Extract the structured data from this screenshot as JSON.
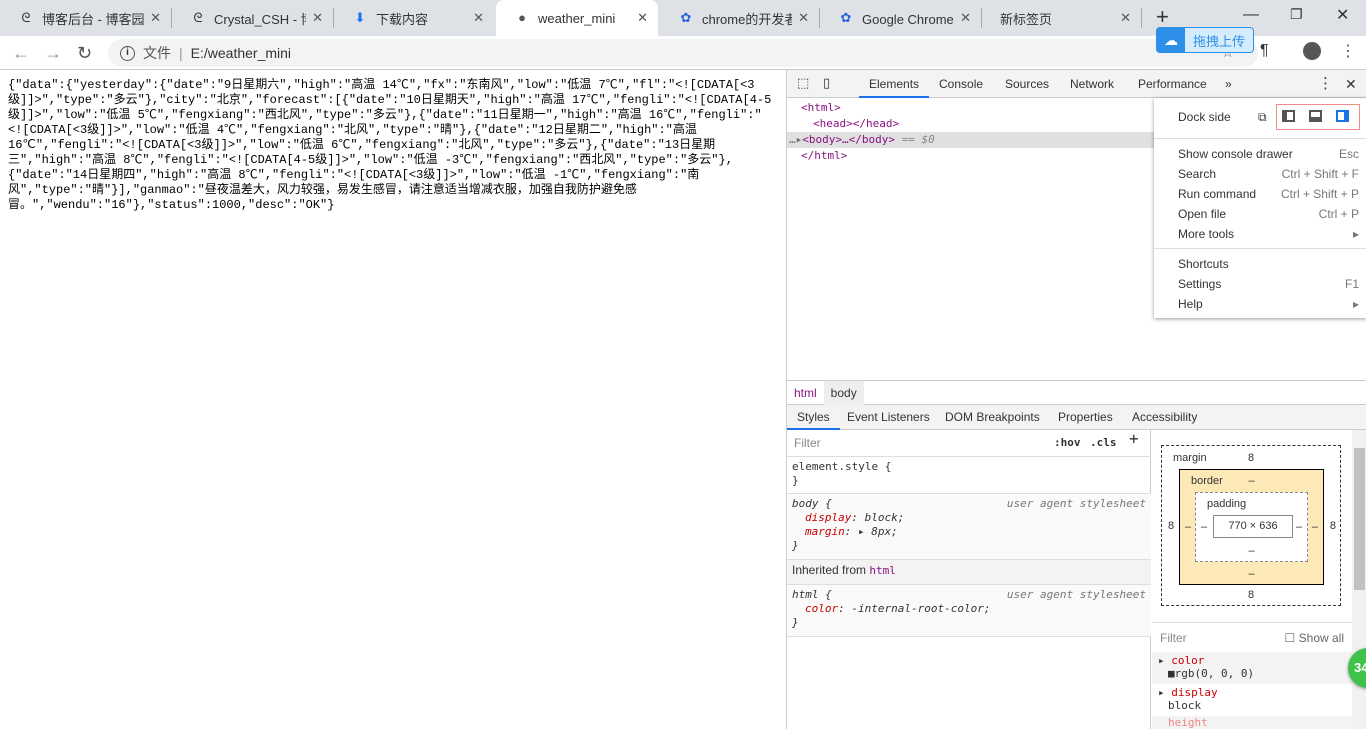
{
  "tabs": [
    {
      "label": "博客后台 - 博客园",
      "icon": "cnblogs-icon"
    },
    {
      "label": "Crystal_CSH - 博客",
      "icon": "cnblogs-icon"
    },
    {
      "label": "下载内容",
      "icon": "download-icon"
    },
    {
      "label": "weather_mini",
      "icon": "globe-icon",
      "active": true
    },
    {
      "label": "chrome的开发者工",
      "icon": "baidu-paw-icon"
    },
    {
      "label": "Google Chrome浏",
      "icon": "baidu-paw-icon"
    },
    {
      "label": "新标签页",
      "icon": ""
    }
  ],
  "address": {
    "scheme_label": "文件",
    "url": "E:/weather_mini"
  },
  "upload_badge": "拖拽上传",
  "page_lines": [
    "{\"data\":{\"yesterday\":{\"date\":\"9日星期六\",\"high\":\"高温 14℃\",\"fx\":\"东南风\",\"low\":\"低温 7℃\",\"fl\":\"<![CDATA[<3",
    "级]]>\",\"type\":\"多云\"},\"city\":\"北京\",\"forecast\":[{\"date\":\"10日星期天\",\"high\":\"高温 17℃\",\"fengli\":\"<![CDATA[4-5",
    "级]]>\",\"low\":\"低温 5℃\",\"fengxiang\":\"西北风\",\"type\":\"多云\"},{\"date\":\"11日星期一\",\"high\":\"高温 16℃\",\"fengli\":\"",
    "<![CDATA[<3级]]>\",\"low\":\"低温 4℃\",\"fengxiang\":\"北风\",\"type\":\"晴\"},{\"date\":\"12日星期二\",\"high\":\"高温",
    "16℃\",\"fengli\":\"<![CDATA[<3级]]>\",\"low\":\"低温 6℃\",\"fengxiang\":\"北风\",\"type\":\"多云\"},{\"date\":\"13日星期",
    "三\",\"high\":\"高温 8℃\",\"fengli\":\"<![CDATA[4-5级]]>\",\"low\":\"低温 -3℃\",\"fengxiang\":\"西北风\",\"type\":\"多云\"},",
    "{\"date\":\"14日星期四\",\"high\":\"高温 8℃\",\"fengli\":\"<![CDATA[<3级]]>\",\"low\":\"低温 -1℃\",\"fengxiang\":\"南",
    "风\",\"type\":\"晴\"}],\"ganmao\":\"昼夜温差大，风力较强，易发生感冒，请注意适当增减衣服，加强自我防护避免感",
    "冒。\",\"wendu\":\"16\"},\"status\":1000,\"desc\":\"OK\"}"
  ],
  "devtools": {
    "tabs": [
      "Elements",
      "Console",
      "Sources",
      "Network",
      "Performance"
    ],
    "more": "»",
    "dom": [
      "<html>",
      "<head></head>",
      "<body>…</body>",
      "== $0",
      "</html>"
    ],
    "menu": {
      "dock_side": "Dock side",
      "items": [
        {
          "label": "Show console drawer",
          "key": "Esc"
        },
        {
          "label": "Search",
          "key": "Ctrl + Shift + F"
        },
        {
          "label": "Run command",
          "key": "Ctrl + Shift + P"
        },
        {
          "label": "Open file",
          "key": "Ctrl + P"
        },
        {
          "label": "More tools",
          "key": "▸"
        },
        {
          "label": "Shortcuts",
          "key": ""
        },
        {
          "label": "Settings",
          "key": "F1"
        },
        {
          "label": "Help",
          "key": "▸"
        }
      ]
    },
    "breadcrumb": [
      "html",
      "body"
    ],
    "subtabs": [
      "Styles",
      "Event Listeners",
      "DOM Breakpoints",
      "Properties",
      "Accessibility"
    ],
    "filter_placeholder": "Filter",
    "hov": ":hov",
    "cls": ".cls",
    "plus": "+",
    "styles": {
      "element_style": "element.style {",
      "close": "}",
      "body_selector": "body {",
      "ua": "user agent stylesheet",
      "display_prop": "display",
      "display_val": "block;",
      "margin_prop": "margin",
      "margin_val": "8px;",
      "inherited_label": "Inherited from",
      "inherited_tag": "html",
      "html_selector": "html {",
      "color_prop": "color",
      "color_val": "-internal-root-color;"
    },
    "box": {
      "margin_label": "margin",
      "border_label": "border",
      "padding_label": "padding",
      "margin": "8",
      "dash": "–",
      "content": "770 × 636"
    },
    "computed": {
      "filter": "Filter",
      "show_all": "Show all",
      "props": [
        {
          "name": "color",
          "value": "rgb(0, 0, 0)"
        },
        {
          "name": "display",
          "value": "block"
        },
        {
          "name": "height",
          "value": ""
        }
      ]
    },
    "badge": "34"
  }
}
